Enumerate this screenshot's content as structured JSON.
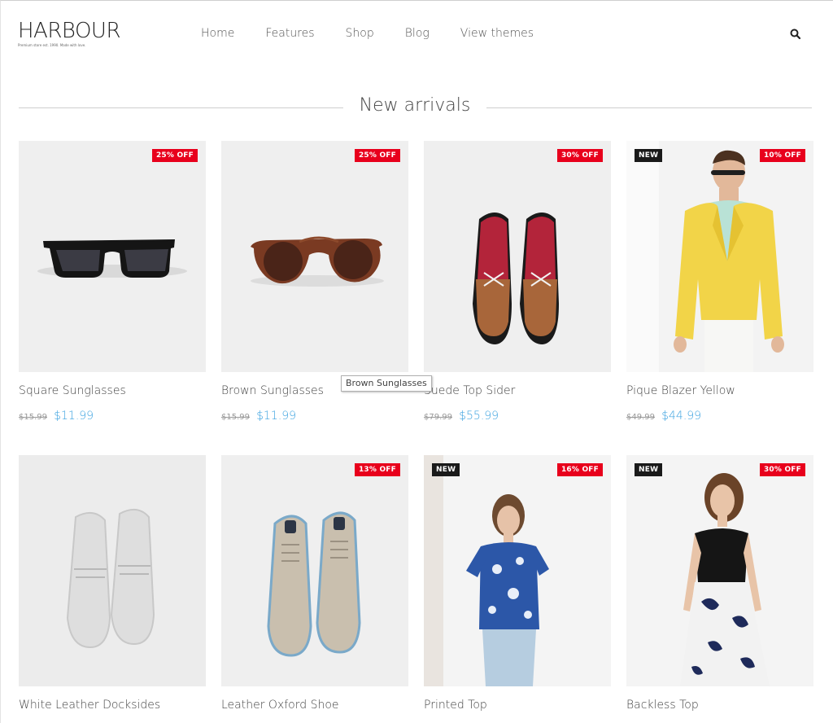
{
  "brand": {
    "name": "HARBOUR",
    "tagline": "Premium store est. 1990. Made with love."
  },
  "nav": {
    "items": [
      "Home",
      "Features",
      "Shop",
      "Blog",
      "View themes"
    ]
  },
  "search": {
    "icon": "search-icon"
  },
  "section": {
    "title": "New arrivals"
  },
  "tooltip": {
    "text": "Brown Sunglasses"
  },
  "colors": {
    "badge_off": "#e8001c",
    "badge_new": "#1a1a1a",
    "price": "#3da3e0"
  },
  "products": [
    {
      "name": "Square Sunglasses",
      "discount": "25% OFF",
      "new": "",
      "old_price": "$15.99",
      "price": "$11.99",
      "image": "square-sunglasses-image"
    },
    {
      "name": "Brown Sunglasses",
      "discount": "25% OFF",
      "new": "",
      "old_price": "$15.99",
      "price": "$11.99",
      "image": "brown-sunglasses-image"
    },
    {
      "name": "Suede Top Sider",
      "discount": "30% OFF",
      "new": "",
      "old_price": "$79.99",
      "price": "$55.99",
      "image": "suede-top-sider-image"
    },
    {
      "name": "Pique Blazer Yellow",
      "discount": "10% OFF",
      "new": "NEW",
      "old_price": "$49.99",
      "price": "$44.99",
      "image": "yellow-blazer-image"
    },
    {
      "name": "White Leather Docksides",
      "discount": "",
      "new": "",
      "old_price": "",
      "price": "",
      "image": "white-docksides-image"
    },
    {
      "name": "Leather Oxford Shoe",
      "discount": "13% OFF",
      "new": "",
      "old_price": "",
      "price": "",
      "image": "oxford-shoe-image"
    },
    {
      "name": "Printed Top",
      "discount": "16% OFF",
      "new": "NEW",
      "old_price": "",
      "price": "",
      "image": "printed-top-image"
    },
    {
      "name": "Backless Top",
      "discount": "30% OFF",
      "new": "NEW",
      "old_price": "",
      "price": "",
      "image": "backless-top-image"
    }
  ]
}
